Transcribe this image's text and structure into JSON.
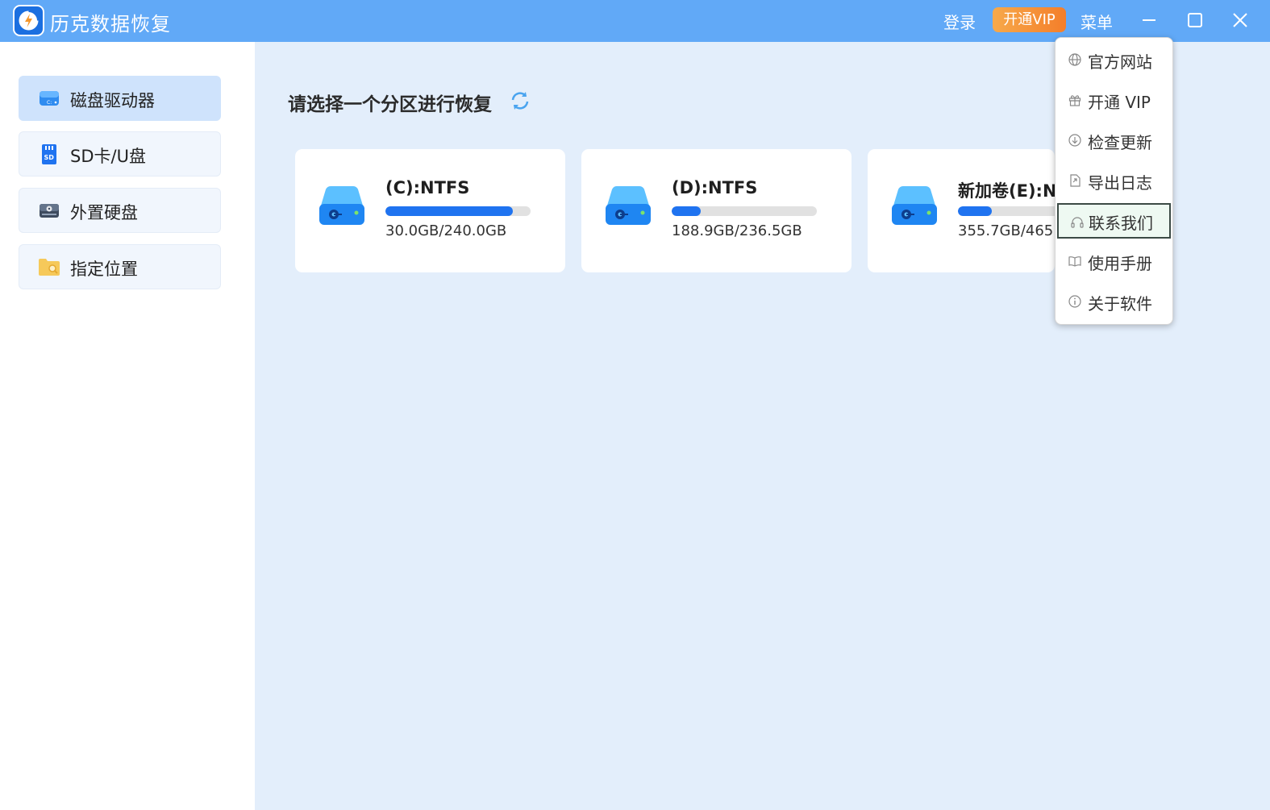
{
  "app": {
    "title": "历克数据恢复",
    "login": "登录",
    "vip_button": "开通VIP",
    "menu_button": "菜单",
    "brand_color": "#61a9f7",
    "accent_color": "#1f73f0",
    "vip_color": "#f47e2a"
  },
  "sidebar": {
    "items": [
      {
        "label": "磁盘驱动器",
        "icon": "disk-drive-icon",
        "active": true
      },
      {
        "label": "SD卡/U盘",
        "icon": "sd-card-icon",
        "active": false
      },
      {
        "label": "外置硬盘",
        "icon": "external-drive-icon",
        "active": false
      },
      {
        "label": "指定位置",
        "icon": "folder-search-icon",
        "active": false
      }
    ]
  },
  "main": {
    "heading": "请选择一个分区进行恢复",
    "drives": [
      {
        "name": "(C):NTFS",
        "size": "30.0GB/240.0GB",
        "fill_percent": 87.5
      },
      {
        "name": "(D):NTFS",
        "size": "188.9GB/236.5GB",
        "fill_percent": 20.1
      },
      {
        "name": "新加卷(E):NTFS",
        "size": "355.7GB/465.",
        "fill_percent": 23.5
      }
    ]
  },
  "menu": {
    "items": [
      {
        "label": "官方网站",
        "icon": "globe-icon"
      },
      {
        "label": "开通 VIP",
        "icon": "gift-icon"
      },
      {
        "label": "检查更新",
        "icon": "download-circle-icon"
      },
      {
        "label": "导出日志",
        "icon": "export-file-icon"
      },
      {
        "label": "联系我们",
        "icon": "headset-icon",
        "selected": true
      },
      {
        "label": "使用手册",
        "icon": "book-icon"
      },
      {
        "label": "关于软件",
        "icon": "info-icon"
      }
    ]
  }
}
